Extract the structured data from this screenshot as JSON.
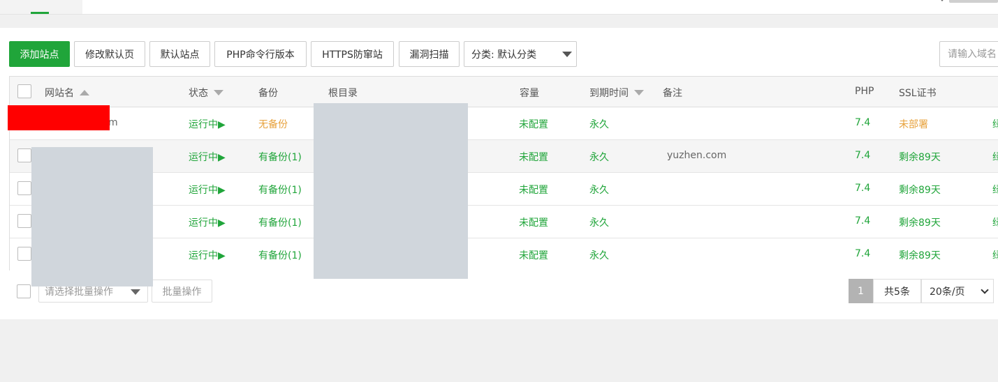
{
  "toolbar": {
    "add_site": "添加站点",
    "edit_default_page": "修改默认页",
    "default_site": "默认站点",
    "php_cli_version": "PHP命令行版本",
    "https_guard": "HTTPS防窜站",
    "vuln_scan": "漏洞扫描",
    "category_select": "分类: 默认分类",
    "search_placeholder": "请输入域名"
  },
  "table": {
    "headers": {
      "site_name": "网站名",
      "status": "状态",
      "backup": "备份",
      "root_dir": "根目录",
      "capacity": "容量",
      "expire": "到期时间",
      "note": "备注",
      "php": "PHP",
      "ssl": "SSL证书"
    },
    "rows": [
      {
        "site_name_fragment": "m",
        "status": "运行中▶",
        "backup": "无备份",
        "capacity": "未配置",
        "expire": "永久",
        "note": "",
        "php": "7.4",
        "ssl": "未部署",
        "trail": "绿"
      },
      {
        "site_name_fragment": "",
        "status": "运行中▶",
        "backup": "有备份(1)",
        "capacity": "未配置",
        "expire": "永久",
        "note": "yuzhen.com",
        "php": "7.4",
        "ssl": "剩余89天",
        "trail": "绿"
      },
      {
        "site_name_fragment": "",
        "status": "运行中▶",
        "backup": "有备份(1)",
        "capacity": "未配置",
        "expire": "永久",
        "note": "",
        "php": "7.4",
        "ssl": "剩余89天",
        "trail": "绿"
      },
      {
        "site_name_fragment": "",
        "status": "运行中▶",
        "backup": "有备份(1)",
        "capacity": "未配置",
        "expire": "永久",
        "note": "",
        "php": "7.4",
        "ssl": "剩余89天",
        "trail": "绿"
      },
      {
        "site_name_fragment": "",
        "status": "运行中▶",
        "backup": "有备份(1)",
        "capacity": "未配置",
        "expire": "永久",
        "note": "",
        "php": "7.4",
        "ssl": "剩余89天",
        "trail": "绿"
      }
    ]
  },
  "footer": {
    "batch_placeholder": "请选择批量操作",
    "batch_button": "批量操作",
    "current_page": "1",
    "total": "共5条",
    "page_size": "20条/页"
  },
  "colors": {
    "accent": "#20a53a",
    "warning": "#e7a13b",
    "redaction_red": "#ff0000",
    "redaction_grey": "#d0d6dc"
  }
}
